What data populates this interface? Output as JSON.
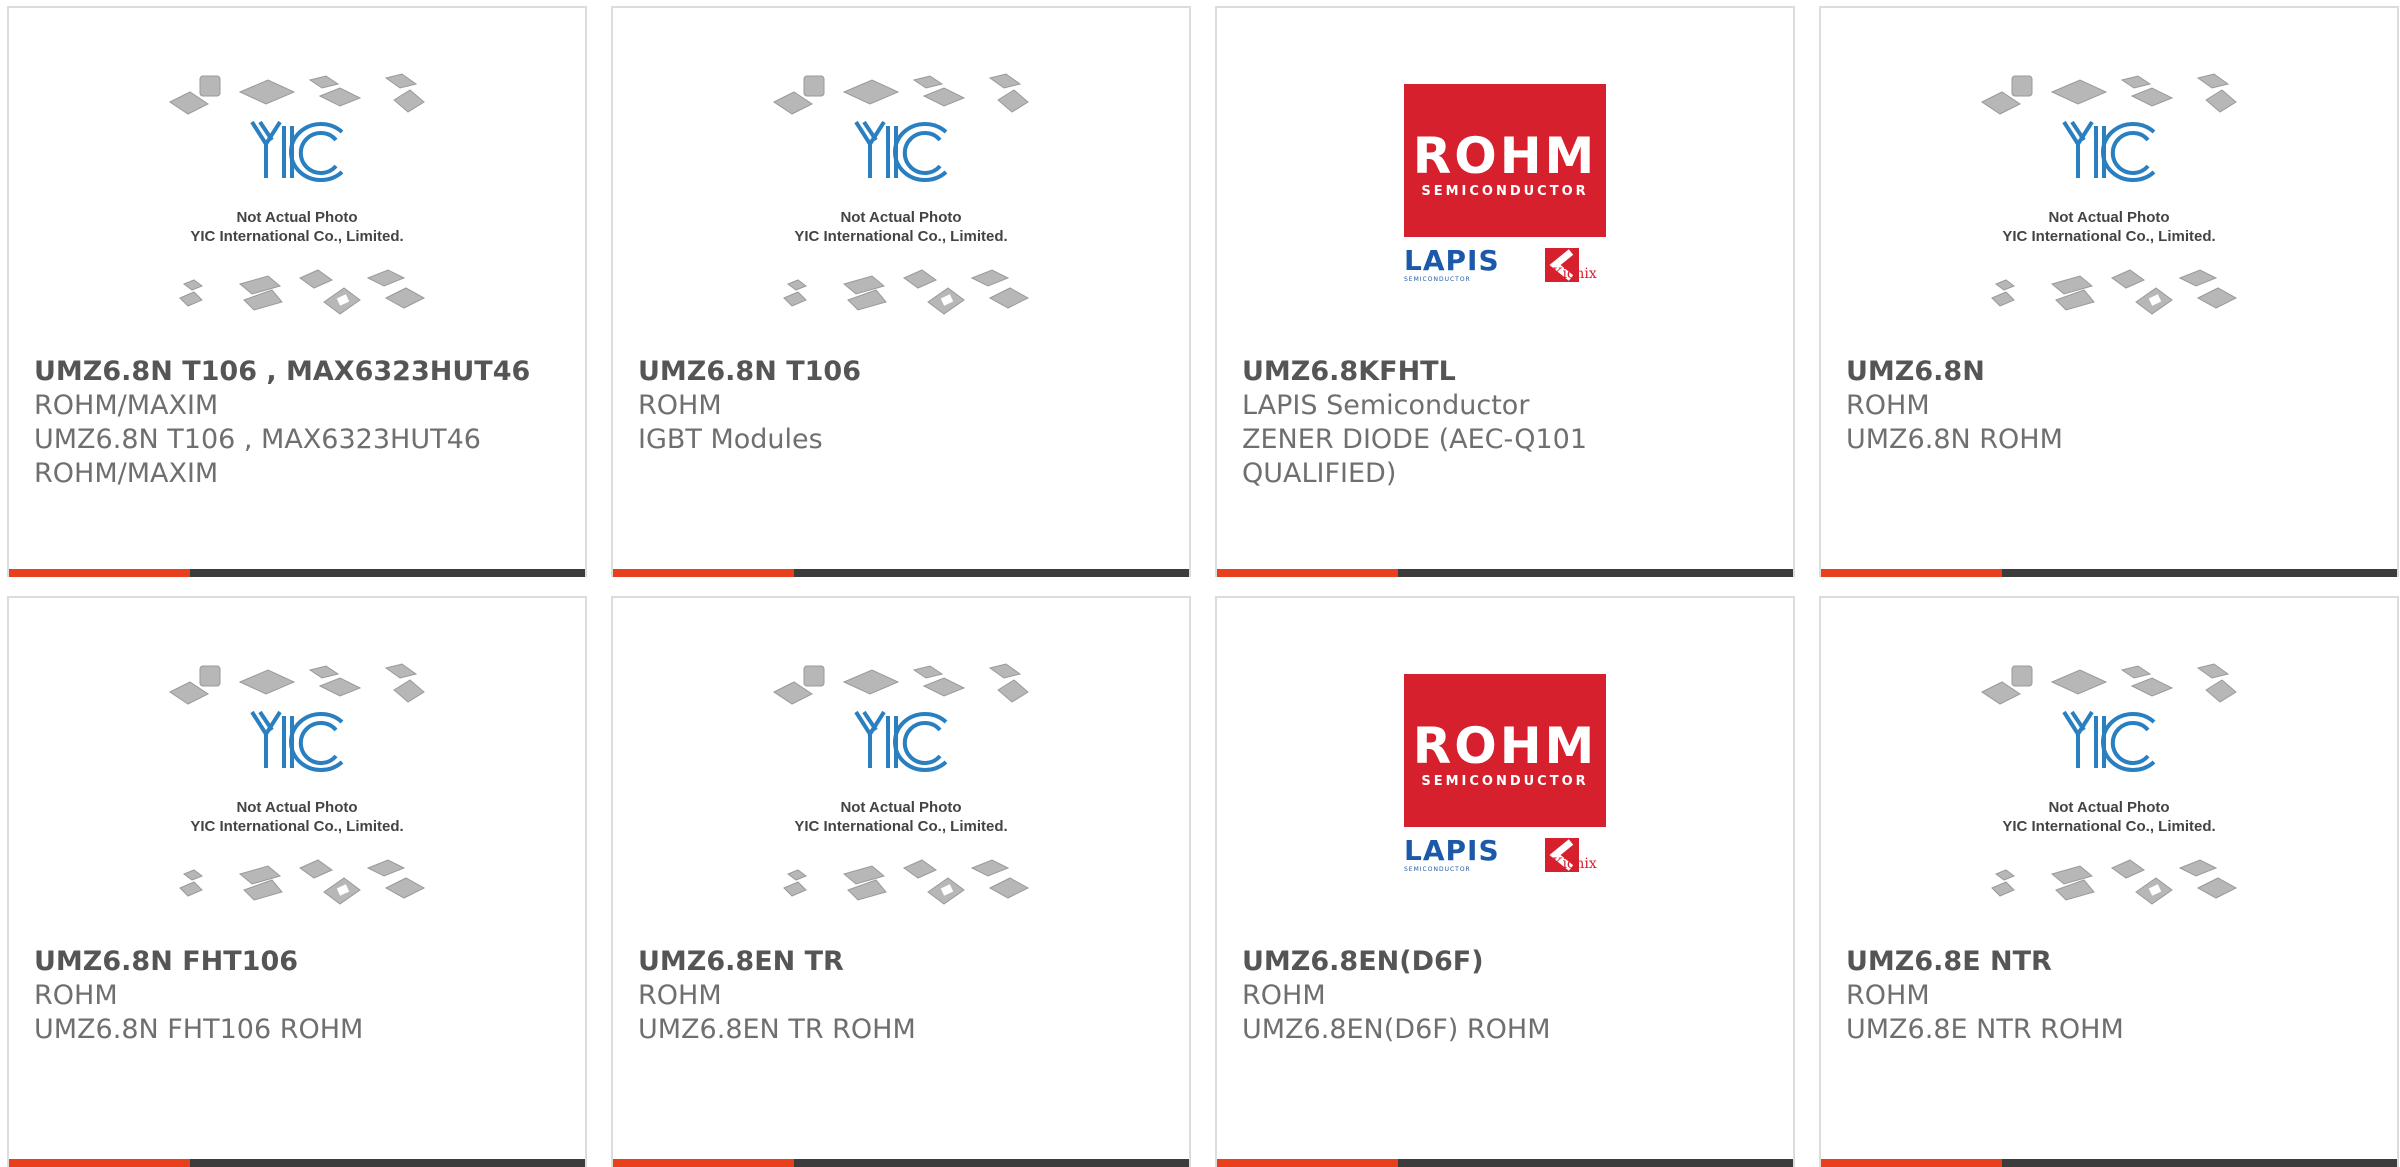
{
  "placeholder": {
    "line1": "Not Actual Photo",
    "line2": "YIC International Co., Limited."
  },
  "logo": {
    "rohm": "ROHM",
    "rohm_sub": "SEMICONDUCTOR",
    "lapis": "LAPIS",
    "lapis_sub": "SEMICONDUCTOR",
    "kionix": "Kionix"
  },
  "colors": {
    "accent": "#e8401c",
    "bar": "#3c3c3c",
    "rohm_red": "#d7202e",
    "lapis_blue": "#1c59a8",
    "yic_blue": "#2a7fc0"
  },
  "products": [
    {
      "title": "UMZ6.8N T106 , MAX6323HUT46",
      "lines": [
        "ROHM/MAXIM",
        "UMZ6.8N T106 , MAX6323HUT46",
        "ROHM/MAXIM"
      ],
      "image": "placeholder"
    },
    {
      "title": "UMZ6.8N T106",
      "lines": [
        "ROHM",
        "IGBT Modules"
      ],
      "image": "placeholder"
    },
    {
      "title": "UMZ6.8KFHTL",
      "lines": [
        "LAPIS Semiconductor",
        "ZENER DIODE (AEC-Q101",
        "QUALIFIED)"
      ],
      "image": "rohm-logo"
    },
    {
      "title": "UMZ6.8N",
      "lines": [
        "ROHM",
        "UMZ6.8N ROHM"
      ],
      "image": "placeholder"
    },
    {
      "title": "UMZ6.8N FHT106",
      "lines": [
        "ROHM",
        "UMZ6.8N FHT106 ROHM"
      ],
      "image": "placeholder"
    },
    {
      "title": "UMZ6.8EN TR",
      "lines": [
        "ROHM",
        "UMZ6.8EN TR ROHM"
      ],
      "image": "placeholder"
    },
    {
      "title": "UMZ6.8EN(D6F)",
      "lines": [
        "ROHM",
        "UMZ6.8EN(D6F) ROHM"
      ],
      "image": "rohm-logo"
    },
    {
      "title": "UMZ6.8E NTR",
      "lines": [
        "ROHM",
        "UMZ6.8E NTR ROHM"
      ],
      "image": "placeholder"
    }
  ]
}
